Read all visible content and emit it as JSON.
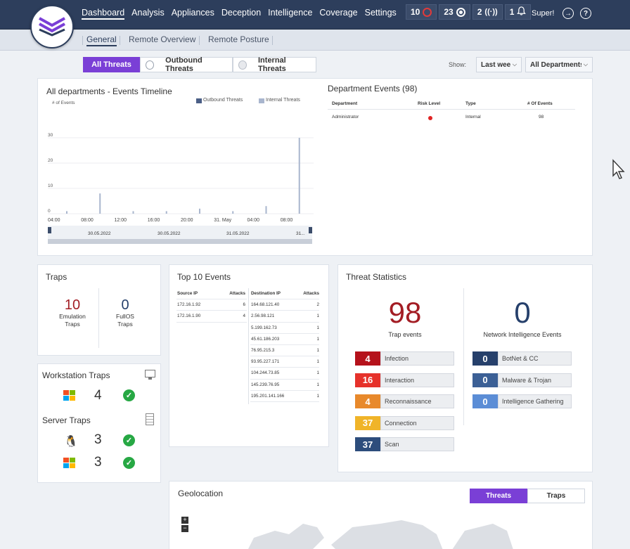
{
  "nav": {
    "items": [
      "Dashboard",
      "Analysis",
      "Appliances",
      "Deception",
      "Intelligence",
      "Coverage",
      "Settings"
    ],
    "counters": [
      {
        "value": "10",
        "icon": "ring-alert-icon"
      },
      {
        "value": "23",
        "icon": "target-icon"
      },
      {
        "value": "2",
        "icon": "broadcast-icon"
      },
      {
        "value": "1",
        "icon": "bell-icon"
      }
    ],
    "user": "Super!"
  },
  "subnav": {
    "tabs": [
      "General",
      "Remote Overview",
      "Remote Posture"
    ]
  },
  "filters": {
    "buttons": [
      "All Threats",
      "Outbound Threats",
      "Internal Threats"
    ],
    "show_label": "Show:",
    "period": "Last week",
    "department": "All Departments"
  },
  "timeline": {
    "title": "All departments - Events Timeline",
    "ylabel": "# of Events",
    "legend": [
      "Outbound Threats",
      "Internal Threats"
    ],
    "yticks": [
      "30",
      "20",
      "10",
      "0"
    ],
    "xticks": [
      "04:00",
      "08:00",
      "12:00",
      "16:00",
      "20:00",
      "31. May",
      "04:00",
      "08:00"
    ],
    "dates": [
      "30.05.2022",
      "30.05.2022",
      "31.05.2022",
      "31..."
    ]
  },
  "chart_data": {
    "type": "bar",
    "title": "All departments - Events Timeline",
    "ylabel": "# of Events",
    "ylim": [
      0,
      40
    ],
    "x": [
      "04:00",
      "08:00",
      "12:00",
      "16:00",
      "20:00",
      "31. May",
      "04:00",
      "08:00"
    ],
    "series": [
      {
        "name": "Outbound Threats",
        "values": [
          0,
          0,
          0,
          0,
          0,
          0,
          0,
          0
        ]
      },
      {
        "name": "Internal Threats",
        "values": [
          1,
          8,
          1,
          1,
          2,
          1,
          3,
          30
        ]
      }
    ]
  },
  "dept_events": {
    "title": "Department Events (98)",
    "headers": [
      "Department",
      "Risk Level",
      "Type",
      "# Of Events"
    ],
    "rows": [
      {
        "department": "Administrator",
        "risk": "high",
        "type": "Internal",
        "events": "98"
      }
    ]
  },
  "traps": {
    "title": "Traps",
    "emulation_value": "10",
    "emulation_label1": "Emulation",
    "emulation_label2": "Traps",
    "fullos_value": "0",
    "fullos_label1": "FullOS",
    "fullos_label2": "Traps"
  },
  "workstation": {
    "title": "Workstation Traps",
    "value": "4"
  },
  "server": {
    "title": "Server Traps",
    "linux_value": "3",
    "windows_value": "3"
  },
  "top10": {
    "title": "Top 10 Events",
    "src_headers": [
      "Source IP",
      "Attacks"
    ],
    "dst_headers": [
      "Destination IP",
      "Attacks"
    ],
    "sources": [
      [
        "172.16.1.92",
        "6"
      ],
      [
        "172.16.1.90",
        "4"
      ]
    ],
    "destinations": [
      [
        "164.68.121.40",
        "2"
      ],
      [
        "2.56.98.121",
        "1"
      ],
      [
        "5.199.162.73",
        "1"
      ],
      [
        "45.61.186.203",
        "1"
      ],
      [
        "76.95.215.3",
        "1"
      ],
      [
        "93.95.227.171",
        "1"
      ],
      [
        "104.244.73.85",
        "1"
      ],
      [
        "145.239.76.95",
        "1"
      ],
      [
        "195.201.141.166",
        "1"
      ]
    ]
  },
  "threat_stats": {
    "title": "Threat Statistics",
    "trap_value": "98",
    "trap_label": "Trap events",
    "net_value": "0",
    "net_label": "Network Intelligence Events",
    "trap_items": [
      {
        "value": "4",
        "label": "Infection",
        "color": "#b5121b"
      },
      {
        "value": "16",
        "label": "Interaction",
        "color": "#e6322b"
      },
      {
        "value": "4",
        "label": "Reconnaissance",
        "color": "#e8892b"
      },
      {
        "value": "37",
        "label": "Connection",
        "color": "#f0b429"
      },
      {
        "value": "37",
        "label": "Scan",
        "color": "#2d4d7c"
      }
    ],
    "net_items": [
      {
        "value": "0",
        "label": "BotNet & CC",
        "color": "#26406b"
      },
      {
        "value": "0",
        "label": "Malware & Trojan",
        "color": "#3c6096"
      },
      {
        "value": "0",
        "label": "Intelligence Gathering",
        "color": "#5b8dd6"
      }
    ]
  },
  "geo": {
    "title": "Geolocation",
    "tabs": [
      "Threats",
      "Traps"
    ],
    "zoom_in": "+",
    "zoom_out": "−"
  }
}
